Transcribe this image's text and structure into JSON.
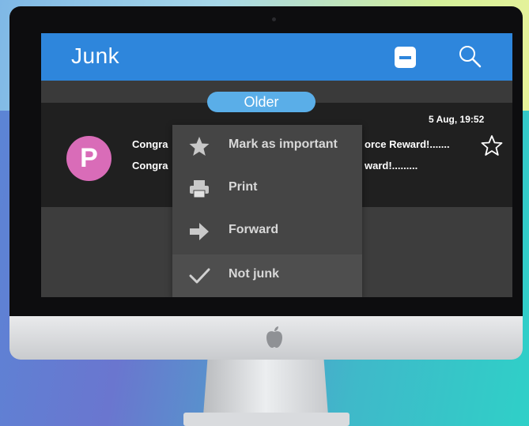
{
  "app": {
    "title": "Junk",
    "actions": [
      {
        "icon": "minus-square-icon"
      },
      {
        "icon": "search-icon"
      }
    ],
    "accent": "#2e86dc"
  },
  "group": {
    "label": "Older",
    "color": "#5aaee8"
  },
  "mail": {
    "date": "5 Aug,  19:52",
    "avatar_letter": "P",
    "avatar_color": "#d96cb8",
    "subject_line_1_left": "Congra",
    "subject_line_1_right": "orce Reward!.......",
    "subject_line_2_left": "Congra",
    "subject_line_2_right": "ward!.........",
    "star_icon": "star-outline-icon"
  },
  "context_menu": {
    "items": [
      {
        "label": "Mark as important",
        "icon": "star-icon"
      },
      {
        "label": "Print",
        "icon": "printer-icon"
      },
      {
        "label": "Forward",
        "icon": "arrow-right-icon"
      },
      {
        "label": "Not junk",
        "icon": "check-icon"
      }
    ]
  },
  "device": {
    "logo_icon": "apple-logo-icon"
  }
}
